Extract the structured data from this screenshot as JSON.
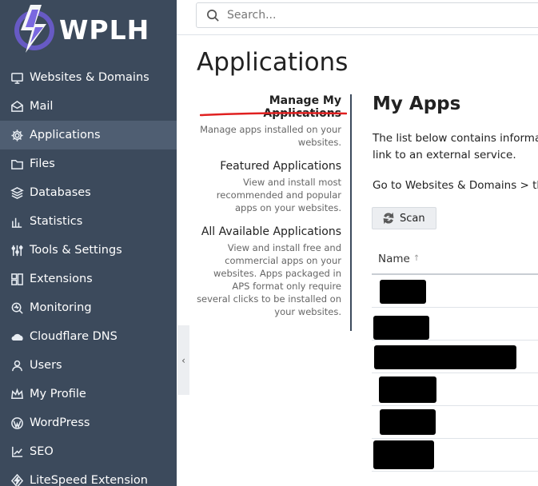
{
  "brand": {
    "name": "WPLH"
  },
  "search": {
    "placeholder": "Search..."
  },
  "sidebar": {
    "items": [
      {
        "label": "Websites & Domains",
        "icon": "monitor-icon"
      },
      {
        "label": "Mail",
        "icon": "mail-icon"
      },
      {
        "label": "Applications",
        "icon": "gear-icon",
        "active": true
      },
      {
        "label": "Files",
        "icon": "folder-icon"
      },
      {
        "label": "Databases",
        "icon": "database-icon"
      },
      {
        "label": "Statistics",
        "icon": "bar-chart-icon"
      },
      {
        "label": "Tools & Settings",
        "icon": "sliders-icon"
      },
      {
        "label": "Extensions",
        "icon": "extensions-icon"
      },
      {
        "label": "Monitoring",
        "icon": "monitoring-icon"
      },
      {
        "label": "Cloudflare DNS",
        "icon": "cloud-icon"
      },
      {
        "label": "Users",
        "icon": "user-icon"
      },
      {
        "label": "My Profile",
        "icon": "crown-icon"
      },
      {
        "label": "WordPress",
        "icon": "wordpress-icon"
      },
      {
        "label": "SEO",
        "icon": "seo-icon"
      },
      {
        "label": "LiteSpeed Extension",
        "icon": "litespeed-icon"
      }
    ]
  },
  "page": {
    "title": "Applications"
  },
  "subnav": {
    "items": [
      {
        "title": "Manage My Applications",
        "desc": "Manage apps installed on your websites.",
        "active": true
      },
      {
        "title": "Featured Applications",
        "desc": "View and install most recommended and popular apps on your websites."
      },
      {
        "title": "All Available Applications",
        "desc": "View and install free and commercial apps on your websites. Apps packaged in APS format only require several clicks to be installed on your websites."
      }
    ]
  },
  "main": {
    "title": "My Apps",
    "description_line1": "The list below contains informat",
    "description_line2": "link to an external service.",
    "go_to_text": "Go to Websites & Domains > the",
    "scan_label": "Scan",
    "table": {
      "column_name": "Name",
      "sort_indicator": "↑"
    }
  },
  "colors": {
    "sidebar_bg": "#3c4a5c",
    "sidebar_active": "#4f5e72",
    "annotation_red": "#e02020"
  }
}
